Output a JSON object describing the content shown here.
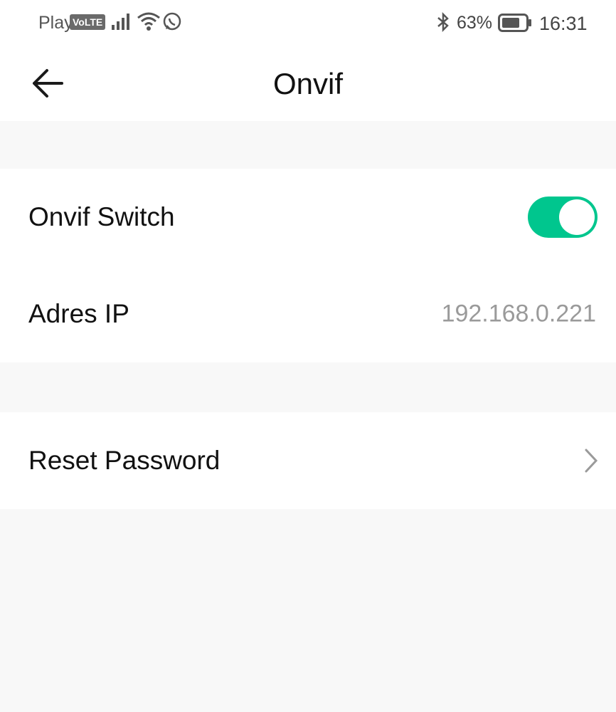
{
  "status_bar": {
    "carrier": "Play",
    "volte_badge": "VoLTE",
    "battery_percent": "63%",
    "time": "16:31",
    "icons": [
      "signal-icon",
      "wifi-icon",
      "whatsapp-icon",
      "bluetooth-icon",
      "battery-icon"
    ]
  },
  "header": {
    "title": "Onvif",
    "back_icon": "arrow-left-icon"
  },
  "settings": {
    "onvif_switch": {
      "label": "Onvif Switch",
      "enabled": true,
      "accent_color": "#00c68e"
    },
    "ip_address": {
      "label": "Adres IP",
      "value": "192.168.0.221"
    },
    "reset_password": {
      "label": "Reset Password",
      "icon": "chevron-right-icon"
    }
  }
}
